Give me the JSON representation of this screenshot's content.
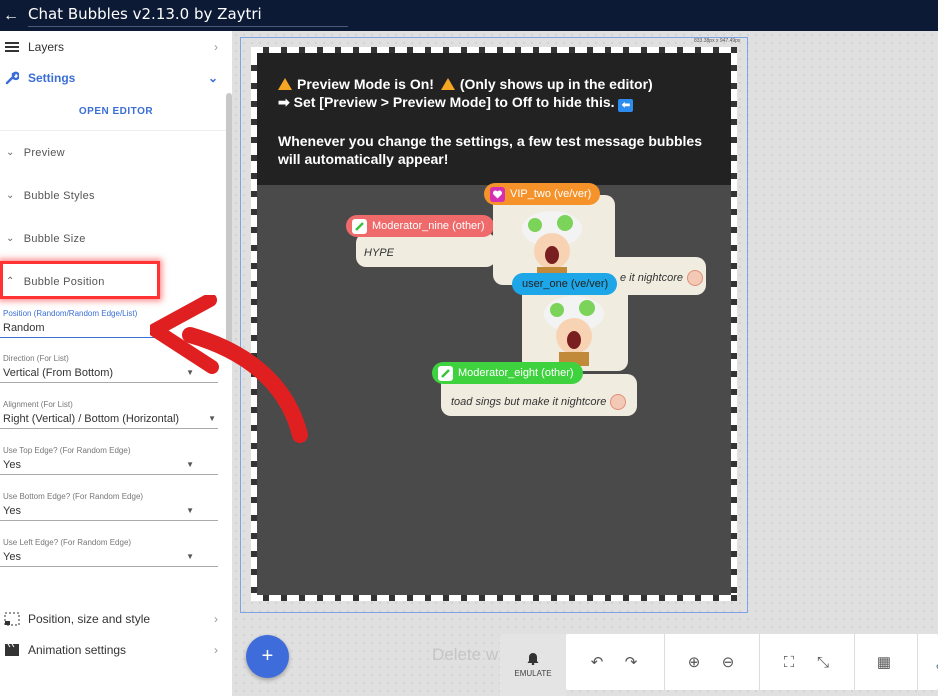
{
  "header": {
    "title": "Chat Bubbles v2.13.0 by Zaytri"
  },
  "sidebar": {
    "layers_label": "Layers",
    "settings_label": "Settings",
    "open_editor_label": "OPEN EDITOR",
    "sections": [
      "Preview",
      "Bubble Styles",
      "Bubble Size",
      "Bubble Position"
    ],
    "fields": [
      {
        "label": "Position (Random/Random Edge/List)",
        "value": "Random"
      },
      {
        "label": "Direction (For List)",
        "value": "Vertical (From Bottom)"
      },
      {
        "label": "Alignment (For List)",
        "value": "Right (Vertical) / Bottom (Horizontal)"
      },
      {
        "label": "Use Top Edge? (For Random Edge)",
        "value": "Yes"
      },
      {
        "label": "Use Bottom Edge? (For Random Edge)",
        "value": "Yes"
      },
      {
        "label": "Use Left Edge? (For Random Edge)",
        "value": "Yes"
      }
    ],
    "bottom_items": [
      "Position, size and style",
      "Animation settings"
    ]
  },
  "canvas": {
    "dimensions": "833.38px x 947.49px",
    "notice": {
      "line1": "Preview Mode is On!",
      "line1b": "(Only shows up in the editor)",
      "line2": "➡ Set [Preview > Preview Mode] to Off to hide this.",
      "line3": "Whenever you change the settings, a few test message bubbles",
      "line4": "will automatically appear!"
    },
    "bubbles": {
      "vip_name": "VIP_two (ve/ver)",
      "mod9_name": "Moderator_nine (other)",
      "mod9_msg": "HYPE",
      "user1_name": "user_one (ve/ver)",
      "hidden_msg": "e it nightcore",
      "mod8_name": "Moderator_eight (other)",
      "mod8_msg": "toad sings but make it nightcore"
    },
    "delete_hint": "Delete w",
    "emulate_label": "EMULATE"
  },
  "colors": {
    "accent": "#3b6fd6",
    "vip": "#f5922a",
    "moderator_nine": "#ef6b6b",
    "user_one": "#1ea7e8",
    "moderator_eight": "#3ed23e",
    "highlight": "#ff3333"
  }
}
